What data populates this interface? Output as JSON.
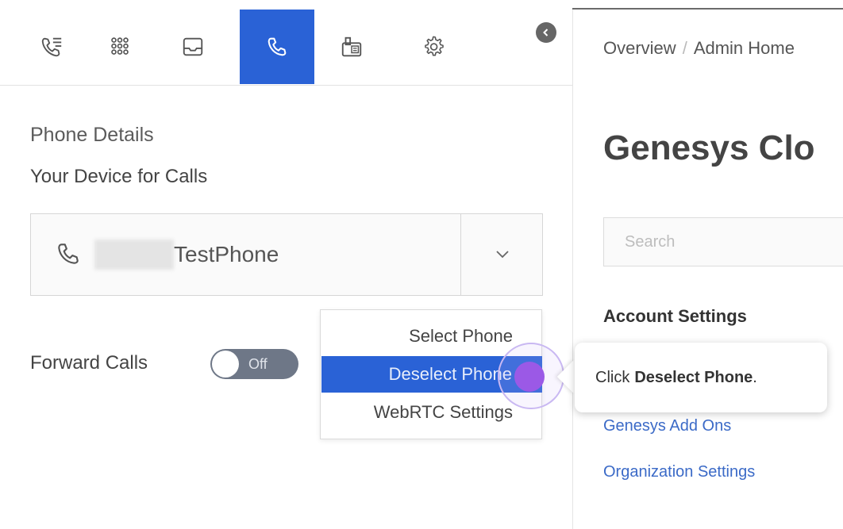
{
  "toolbar": {
    "buttons": [
      {
        "name": "call-history-icon",
        "active": false
      },
      {
        "name": "apps-grid-icon",
        "active": false
      },
      {
        "name": "inbox-icon",
        "active": false
      },
      {
        "name": "phone-icon",
        "active": true
      },
      {
        "name": "fax-icon",
        "active": false
      },
      {
        "name": "gear-icon",
        "active": false
      }
    ],
    "accent_color": "#2a62d6"
  },
  "phone_details": {
    "title": "Phone Details",
    "device_label": "Your Device for Calls",
    "device_name": "TestPhone",
    "forward_label": "Forward Calls",
    "forward_toggle_text": "Off"
  },
  "menu": {
    "items": [
      "Select Phone",
      "Deselect Phone",
      "WebRTC Settings"
    ],
    "selected_index": 1
  },
  "tooltip": {
    "prefix": "Click",
    "bold": "Deselect Phone",
    "suffix": "."
  },
  "right": {
    "breadcrumb": [
      "Overview",
      "Admin Home"
    ],
    "title": "Genesys Clo",
    "search_placeholder": "Search",
    "section_heading": "Account Settings",
    "links": [
      "Genesys Add Ons",
      "Organization Settings"
    ]
  }
}
